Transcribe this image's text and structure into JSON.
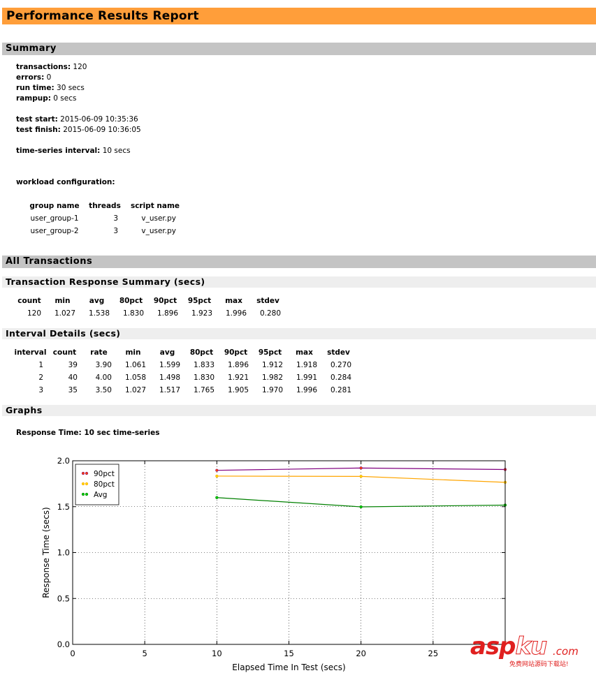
{
  "report_title": "Performance Results Report",
  "summary": {
    "heading": "Summary",
    "transactions_label": "transactions:",
    "transactions": "120",
    "errors_label": "errors:",
    "errors": "0",
    "run_time_label": "run time:",
    "run_time": "30 secs",
    "rampup_label": "rampup:",
    "rampup": "0 secs",
    "test_start_label": "test start:",
    "test_start": "2015-06-09 10:35:36",
    "test_finish_label": "test finish:",
    "test_finish": "2015-06-09 10:36:05",
    "interval_label": "time-series interval:",
    "interval": "10 secs",
    "workload_label": "workload configuration:",
    "workload": {
      "headers": [
        "group name",
        "threads",
        "script name"
      ],
      "rows": [
        [
          "user_group-1",
          "3",
          "v_user.py"
        ],
        [
          "user_group-2",
          "3",
          "v_user.py"
        ]
      ]
    }
  },
  "all_transactions": {
    "heading": "All Transactions",
    "response_summary": {
      "heading": "Transaction Response Summary (secs)",
      "headers": [
        "count",
        "min",
        "avg",
        "80pct",
        "90pct",
        "95pct",
        "max",
        "stdev"
      ],
      "row": [
        "120",
        "1.027",
        "1.538",
        "1.830",
        "1.896",
        "1.923",
        "1.996",
        "0.280"
      ]
    },
    "interval_details": {
      "heading": "Interval Details (secs)",
      "headers": [
        "interval",
        "count",
        "rate",
        "min",
        "avg",
        "80pct",
        "90pct",
        "95pct",
        "max",
        "stdev"
      ],
      "rows": [
        [
          "1",
          "39",
          "3.90",
          "1.061",
          "1.599",
          "1.833",
          "1.896",
          "1.912",
          "1.918",
          "0.270"
        ],
        [
          "2",
          "40",
          "4.00",
          "1.058",
          "1.498",
          "1.830",
          "1.921",
          "1.982",
          "1.991",
          "0.284"
        ],
        [
          "3",
          "35",
          "3.50",
          "1.027",
          "1.517",
          "1.765",
          "1.905",
          "1.970",
          "1.996",
          "0.281"
        ]
      ]
    }
  },
  "graphs": {
    "heading": "Graphs",
    "response_time_title": "Response Time: 10 sec time-series"
  },
  "chart_data": {
    "type": "line",
    "title": "",
    "xlabel": "Elapsed Time In Test (secs)",
    "ylabel": "Response Time (secs)",
    "xlim": [
      0,
      30
    ],
    "ylim": [
      0,
      2.0
    ],
    "x_ticks": [
      "0",
      "5",
      "10",
      "15",
      "20",
      "25"
    ],
    "y_ticks": [
      "0.0",
      "0.5",
      "1.0",
      "1.5",
      "2.0"
    ],
    "grid": true,
    "legend_position": "top-left",
    "x": [
      10,
      20,
      30
    ],
    "series": [
      {
        "name": "90pct",
        "values": [
          1.896,
          1.921,
          1.905
        ],
        "color": "#800080",
        "marker_color": "#ff4500"
      },
      {
        "name": "80pct",
        "values": [
          1.833,
          1.83,
          1.765
        ],
        "color": "#ffa500",
        "marker_color": "#ffd700"
      },
      {
        "name": "Avg",
        "values": [
          1.599,
          1.498,
          1.517
        ],
        "color": "#008000",
        "marker_color": "#00cc00"
      }
    ]
  },
  "watermark": {
    "brand_main": "asp",
    "brand_ku": "ku",
    "brand_com": ".com",
    "slogan": "免费网站源码下载站!"
  }
}
